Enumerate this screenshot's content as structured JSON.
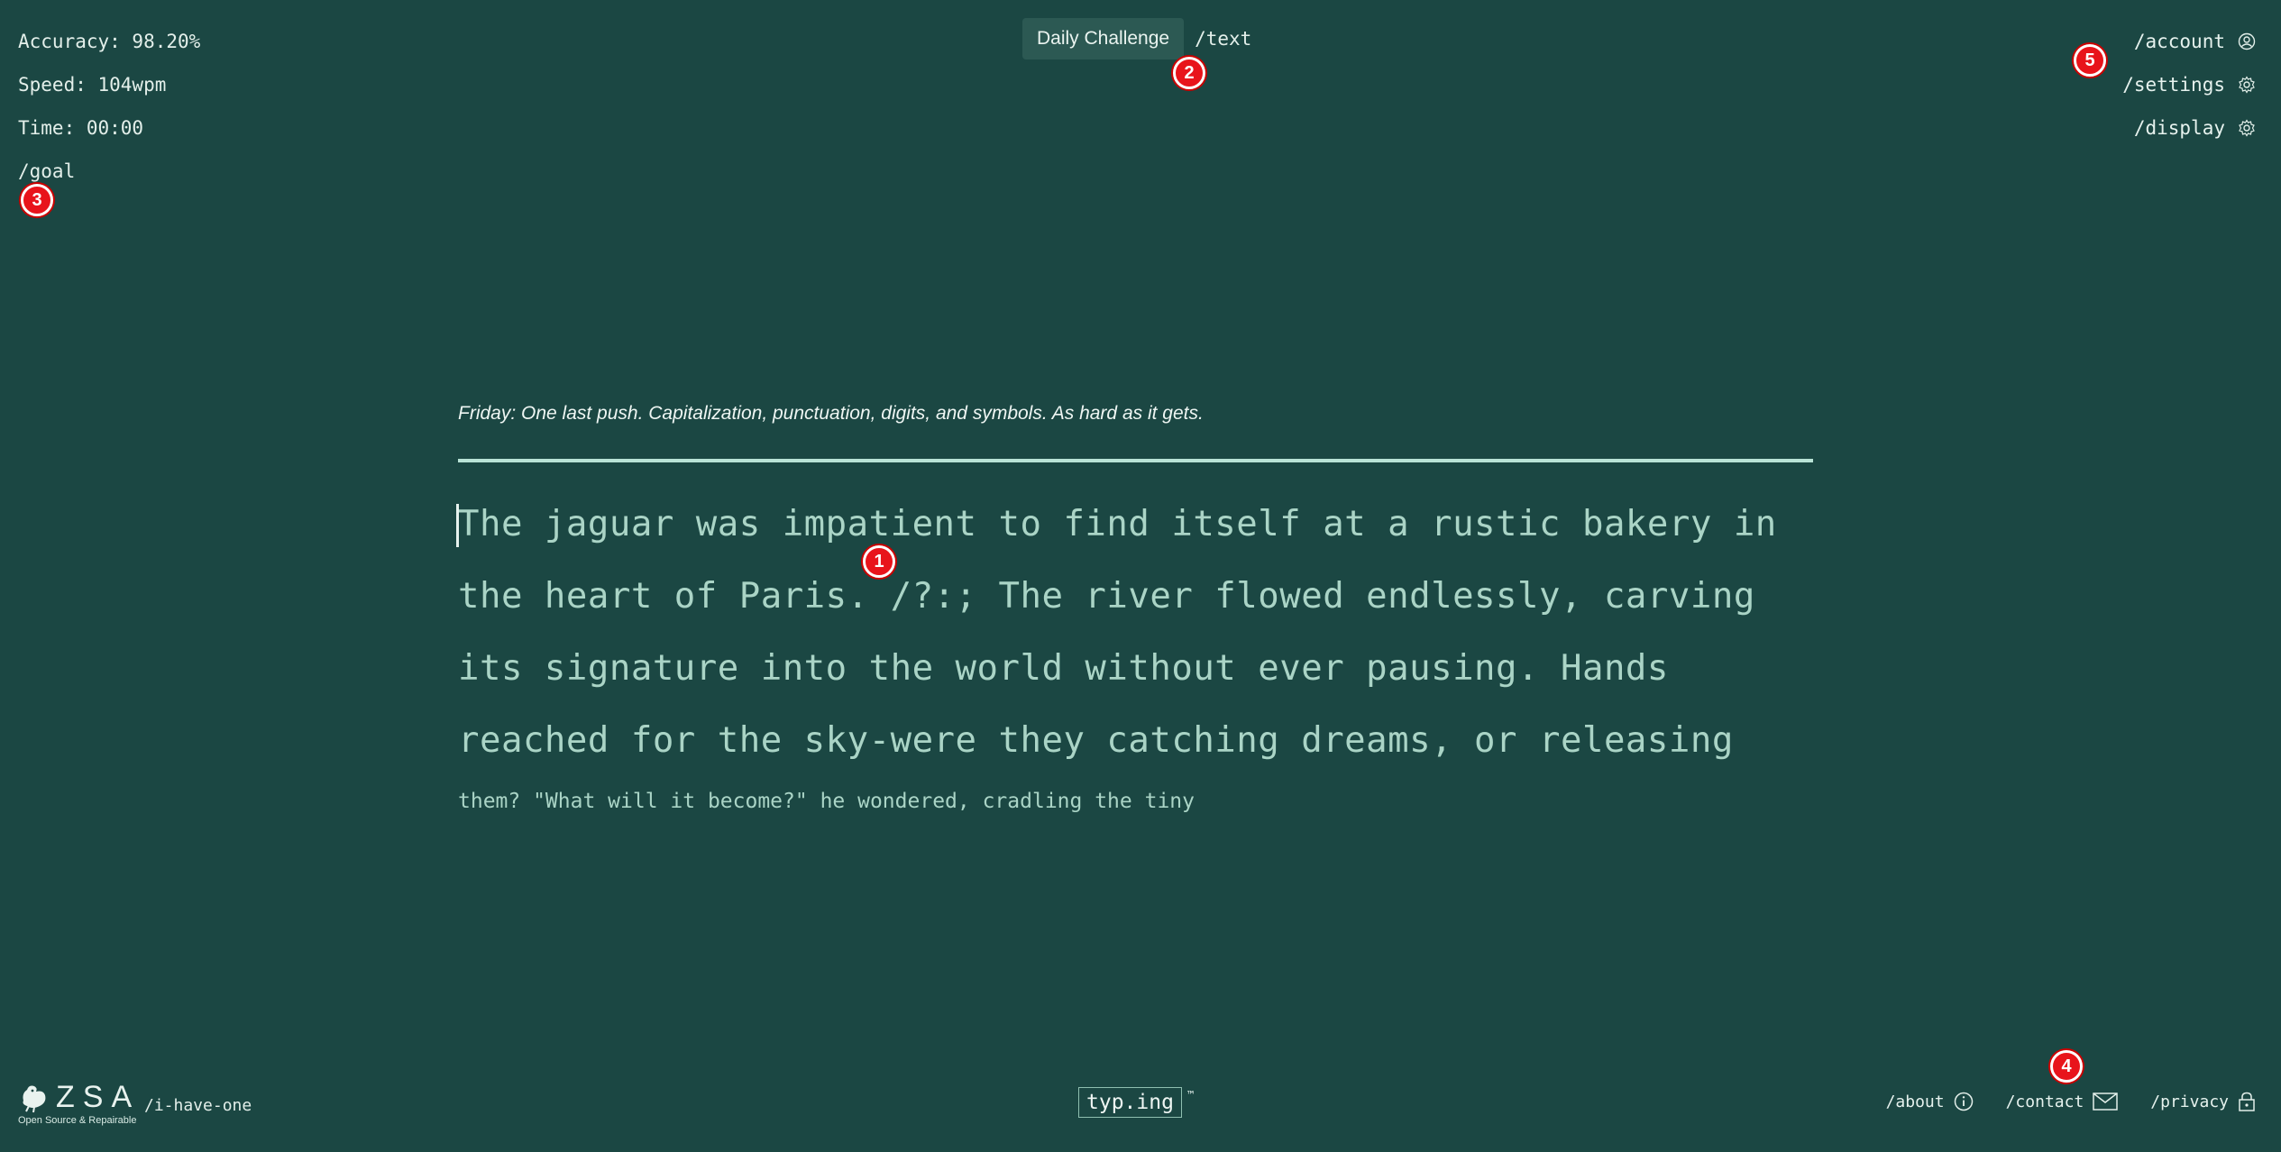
{
  "stats": {
    "accuracy": "Accuracy: 98.20%",
    "speed": "Speed: 104wpm",
    "time": "Time: 00:00",
    "goal": "/goal"
  },
  "top_center": {
    "daily_challenge": "Daily Challenge",
    "text_link": "/text"
  },
  "top_right": {
    "account": "/account",
    "settings": "/settings",
    "display": "/display"
  },
  "main": {
    "description": "Friday: One last push. Capitalization, punctuation, digits, and symbols. As hard as it gets.",
    "lines": [
      "The jaguar was impatient to find itself at a rustic bakery in",
      "the heart of Paris. /?:; The river flowed endlessly, carving",
      "its signature into the world without ever pausing. Hands",
      "reached for the sky-were they catching dreams, or releasing"
    ],
    "next_line": "them? \"What will it become?\" he wondered, cradling the tiny"
  },
  "badges": {
    "b1": "1",
    "b2": "2",
    "b3": "3",
    "b4": "4",
    "b5": "5"
  },
  "footer": {
    "zsa_logo": "ZSA",
    "zsa_tagline": "Open Source & Repairable",
    "i_have_one": "/i-have-one",
    "brand": "typ.ing",
    "trademark": "™",
    "about": "/about",
    "contact": "/contact",
    "privacy": "/privacy"
  },
  "colors": {
    "background": "#1b4743",
    "typing_text": "#aad4c6",
    "rule": "#b9e3d6",
    "badge": "#e8141b"
  }
}
